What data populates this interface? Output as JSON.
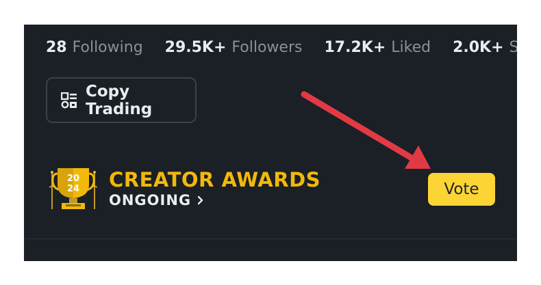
{
  "stats": [
    {
      "value": "28",
      "label": "Following"
    },
    {
      "value": "29.5K+",
      "label": "Followers"
    },
    {
      "value": "17.2K+",
      "label": "Liked"
    },
    {
      "value": "2.0K+",
      "label": "Shares"
    }
  ],
  "copy_trading": {
    "label": "Copy Trading",
    "icon": "copy-trading-icon"
  },
  "awards": {
    "title": "CREATOR AWARDS",
    "status": "ONGOING",
    "trophy_year_top": "20",
    "trophy_year_bottom": "24"
  },
  "vote_button": {
    "label": "Vote"
  },
  "colors": {
    "background": "#1b1f26",
    "accent": "#f0b90b",
    "button": "#fcd535",
    "arrow": "#e23a45"
  }
}
